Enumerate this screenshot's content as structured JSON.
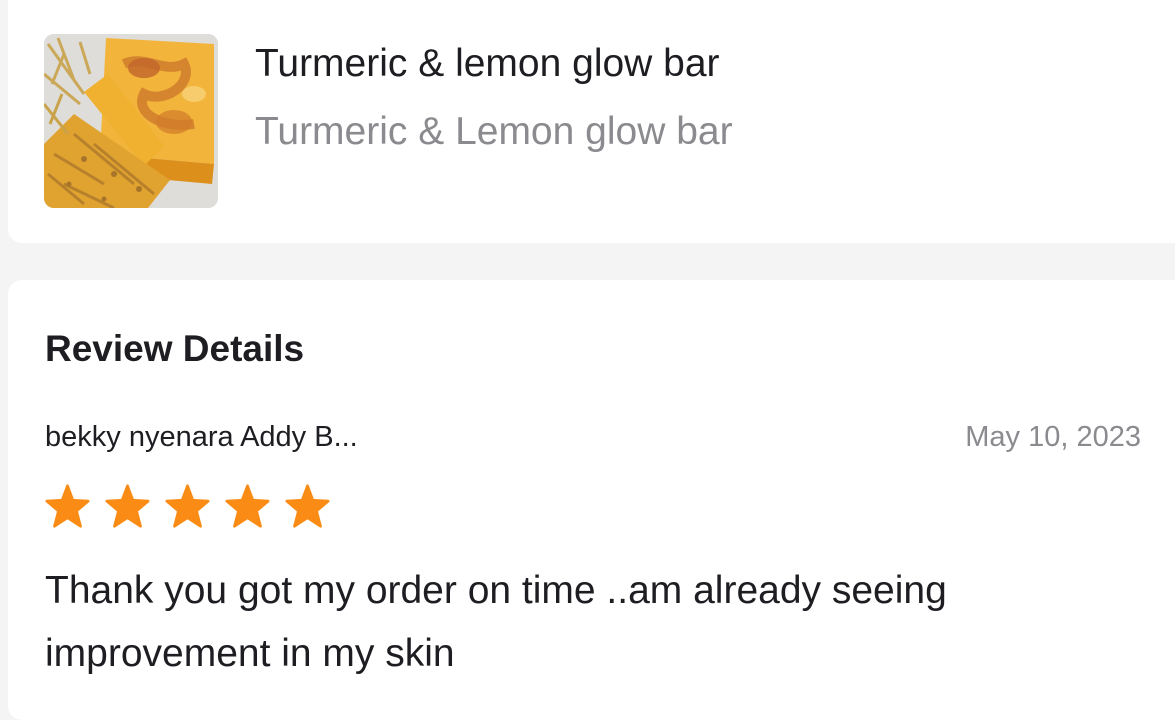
{
  "product": {
    "name": "Turmeric & lemon glow bar",
    "variant": "Turmeric & Lemon glow bar",
    "thumbnail_icon": "soap-bar-photo"
  },
  "review": {
    "section_title": "Review Details",
    "reviewer": "bekky nyenara Addy B...",
    "date": "May 10, 2023",
    "rating": 5,
    "max_rating": 5,
    "text": "Thank you got my order on time ..am already seeing improvement in my skin"
  },
  "colors": {
    "star": "#fa8c16",
    "text_primary": "#1d1d22",
    "text_secondary": "#8a8a8f",
    "page_background": "#f4f4f4",
    "card_background": "#ffffff"
  }
}
